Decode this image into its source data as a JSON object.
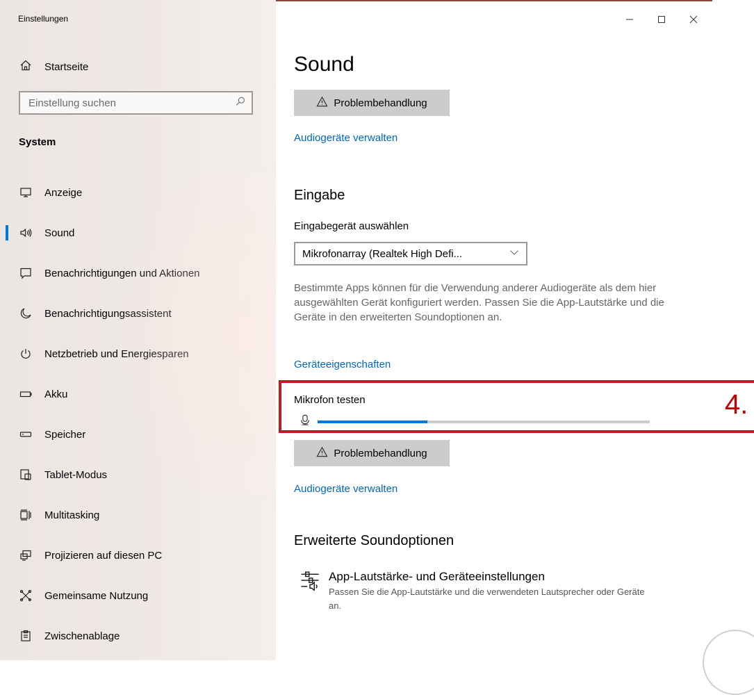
{
  "window": {
    "title": "Einstellungen",
    "controls": {
      "minimize": "minimize-icon",
      "maximize": "maximize-icon",
      "close": "close-icon"
    }
  },
  "sidebar": {
    "home_label": "Startseite",
    "search_placeholder": "Einstellung suchen",
    "section_label": "System",
    "active_item": "Sound",
    "items": [
      {
        "label": "Anzeige",
        "icon": "monitor-icon"
      },
      {
        "label": "Sound",
        "icon": "speaker-icon"
      },
      {
        "label": "Benachrichtigungen und Aktionen",
        "icon": "notification-icon"
      },
      {
        "label": "Benachrichtigungsassistent",
        "icon": "moon-icon"
      },
      {
        "label": "Netzbetrieb und Energiesparen",
        "icon": "power-icon"
      },
      {
        "label": "Akku",
        "icon": "battery-icon"
      },
      {
        "label": "Speicher",
        "icon": "storage-icon"
      },
      {
        "label": "Tablet-Modus",
        "icon": "tablet-icon"
      },
      {
        "label": "Multitasking",
        "icon": "multitasking-icon"
      },
      {
        "label": "Projizieren auf diesen PC",
        "icon": "project-icon"
      },
      {
        "label": "Gemeinsame Nutzung",
        "icon": "share-icon"
      },
      {
        "label": "Zwischenablage",
        "icon": "clipboard-icon"
      }
    ]
  },
  "main": {
    "title": "Sound",
    "troubleshoot_label": "Problembehandlung",
    "manage_devices_link": "Audiogeräte verwalten",
    "input": {
      "heading": "Eingabe",
      "select_label": "Eingabegerät auswählen",
      "selected_device": "Mikrofonarray (Realtek High Defi...",
      "description": "Bestimmte Apps können für die Verwendung anderer Audiogeräte als dem hier ausgewählten Gerät konfiguriert werden. Passen Sie die App-Lautstärke und die Geräte in den erweiterten Soundoptionen an.",
      "properties_link": "Geräteeigenschaften",
      "mic_test_label": "Mikrofon testen",
      "mic_level_fraction": 0.33,
      "troubleshoot_label": "Problembehandlung",
      "manage_devices_link": "Audiogeräte verwalten"
    },
    "advanced": {
      "heading": "Erweiterte Soundoptionen",
      "app_volume_title": "App-Lautstärke- und Geräteeinstellungen",
      "app_volume_desc": "Passen Sie die App-Lautstärke und die verwendeten Lautsprecher oder Geräte an."
    }
  },
  "annotation": {
    "step_number": "4.",
    "color": "#b41e24"
  },
  "colors": {
    "accent": "#0078d7",
    "link": "#0067c0",
    "button_bg": "#cccccc"
  }
}
